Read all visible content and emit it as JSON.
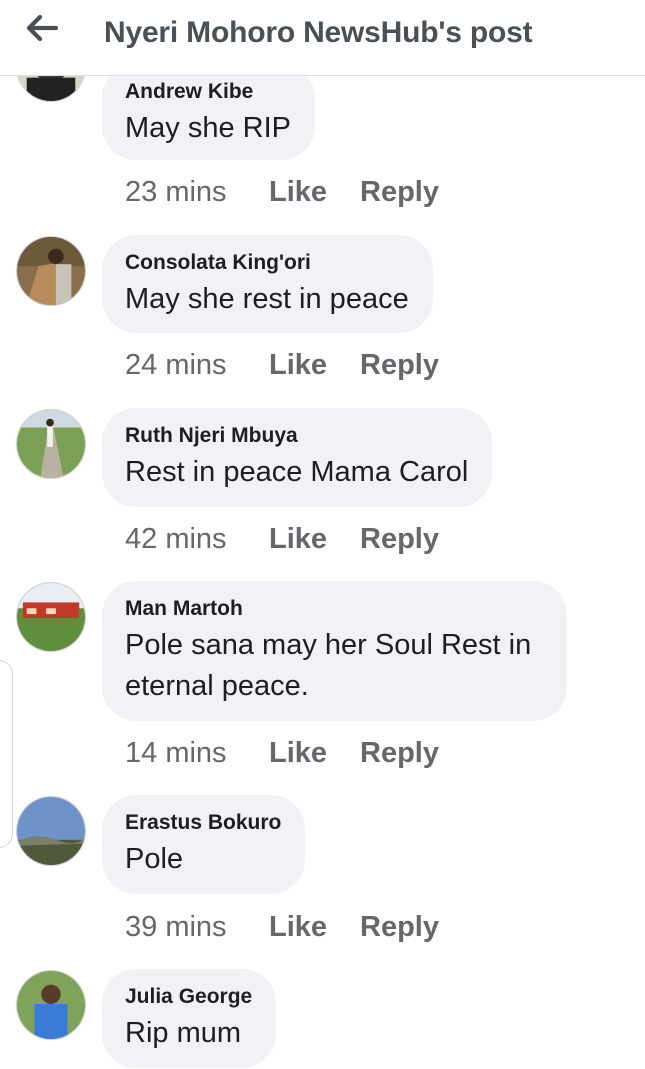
{
  "header": {
    "title": "Nyeri Mohoro NewsHub's post",
    "back_icon": "back-arrow-icon"
  },
  "comments": [
    {
      "author": "Andrew Kibe",
      "text": "May she RIP",
      "time": "23 mins",
      "like_label": "Like",
      "reply_label": "Reply"
    },
    {
      "author": "Consolata King'ori",
      "text": "May she rest in peace",
      "time": "24 mins",
      "like_label": "Like",
      "reply_label": "Reply"
    },
    {
      "author": "Ruth Njeri Mbuya",
      "text": "Rest in peace Mama Carol",
      "time": "42 mins",
      "like_label": "Like",
      "reply_label": "Reply"
    },
    {
      "author": "Man Martoh",
      "text": "Pole sana may her Soul Rest in eternal peace.",
      "time": "14 mins",
      "like_label": "Like",
      "reply_label": "Reply"
    },
    {
      "author": "Erastus Bokuro",
      "text": "Pole",
      "time": "39 mins",
      "like_label": "Like",
      "reply_label": "Reply"
    },
    {
      "author": "Julia George",
      "text": "Rip mum",
      "time": "",
      "like_label": "",
      "reply_label": ""
    }
  ],
  "colors": {
    "bubble_bg": "#f0f2f5",
    "text": "#1c1e21",
    "meta": "#65676b",
    "header_title": "#4b4f56"
  }
}
